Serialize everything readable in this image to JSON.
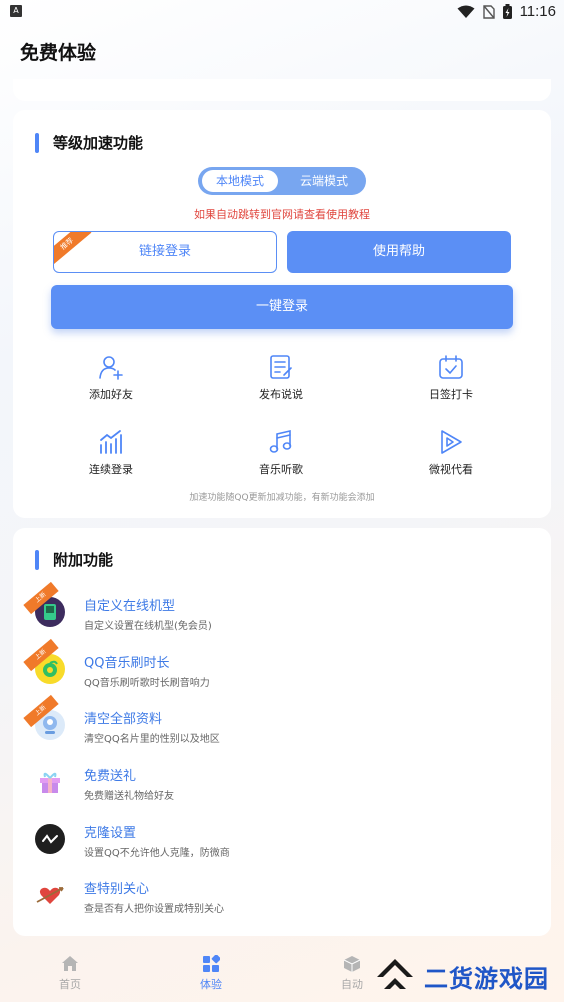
{
  "status_bar": {
    "app_icon_letter": "A",
    "time": "11:16"
  },
  "page": {
    "title": "免费体验"
  },
  "accel_section": {
    "title": "等级加速功能",
    "mode_toggle": {
      "options": [
        "本地模式",
        "云端模式"
      ],
      "selected": "本地模式"
    },
    "notice": "如果自动跳转到官网请查看使用教程",
    "link_login_label": "链接登录",
    "link_login_ribbon": "推荐",
    "help_label": "使用帮助",
    "onekey_login_label": "一键登录",
    "features": [
      {
        "label": "添加好友",
        "icon": "add-friend-icon"
      },
      {
        "label": "发布说说",
        "icon": "post-note-icon"
      },
      {
        "label": "日签打卡",
        "icon": "calendar-check-icon"
      },
      {
        "label": "连续登录",
        "icon": "bar-chart-icon"
      },
      {
        "label": "音乐听歌",
        "icon": "music-note-icon"
      },
      {
        "label": "微视代看",
        "icon": "play-video-icon"
      }
    ],
    "footnote": "加速功能随QQ更新加减功能，有新功能会添加"
  },
  "extra_section": {
    "title": "附加功能",
    "items": [
      {
        "title": "自定义在线机型",
        "desc": "自定义设置在线机型(免会员)",
        "ribbon": "上新",
        "icon": "phone-model-icon",
        "icon_color": "#7b5cc9"
      },
      {
        "title": "QQ音乐刷时长",
        "desc": "QQ音乐刷听歌时长刷音响力",
        "ribbon": "上新",
        "icon": "qq-music-icon",
        "icon_color": "#f5d21f"
      },
      {
        "title": "清空全部资料",
        "desc": "清空QQ名片里的性别以及地区",
        "ribbon": "上新",
        "icon": "profile-clear-icon",
        "icon_color": "#8fb8ee"
      },
      {
        "title": "免费送礼",
        "desc": "免费赠送礼物给好友",
        "ribbon": "",
        "icon": "gift-icon",
        "icon_color": "#d28ee8"
      },
      {
        "title": "克隆设置",
        "desc": "设置QQ不允许他人克隆，防微商",
        "ribbon": "",
        "icon": "clone-icon",
        "icon_color": "#222222"
      },
      {
        "title": "查特别关心",
        "desc": "查是否有人把你设置成特别关心",
        "ribbon": "",
        "icon": "heart-arrow-icon",
        "icon_color": "#e0463e"
      }
    ]
  },
  "bottom_nav": {
    "items": [
      {
        "label": "首页",
        "icon": "home-icon",
        "active": false
      },
      {
        "label": "体验",
        "icon": "grid-icon",
        "active": true
      },
      {
        "label": "自动",
        "icon": "cube-icon",
        "active": false
      }
    ]
  },
  "watermark": {
    "text": "二货游戏园"
  },
  "colors": {
    "accent": "#5b8ff5",
    "notice_red": "#e0463e",
    "ribbon_orange": "#f07a2a"
  }
}
